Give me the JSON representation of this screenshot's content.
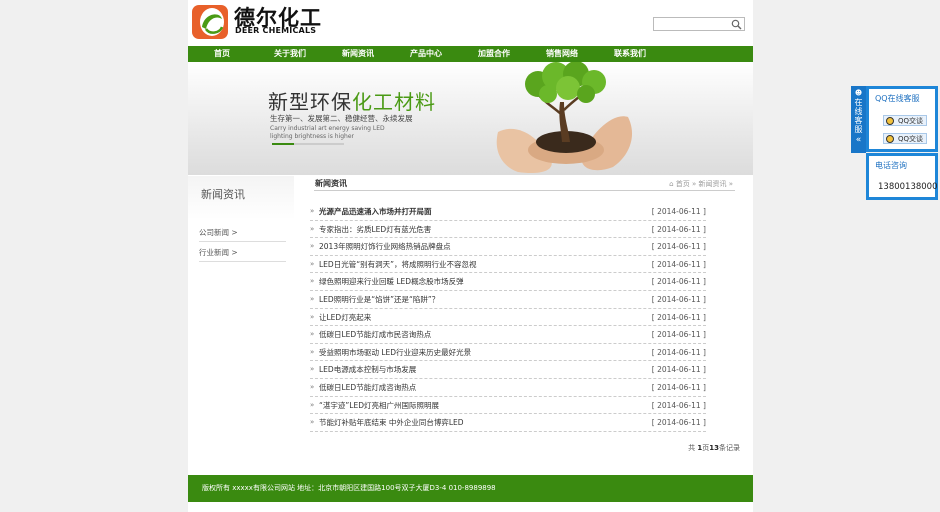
{
  "header": {
    "brand_cn": "德尔化工",
    "brand_en": "DEER CHEMICALS",
    "search_placeholder": "",
    "colors": {
      "brand_green": "#3a8a10",
      "logo_orange": "#e8602a",
      "logo_green": "#4a9a14"
    }
  },
  "nav": {
    "items": [
      {
        "label": "首页"
      },
      {
        "label": "关于我们"
      },
      {
        "label": "新闻资讯"
      },
      {
        "label": "产品中心"
      },
      {
        "label": "加盟合作"
      },
      {
        "label": "销售网络"
      },
      {
        "label": "联系我们"
      }
    ]
  },
  "banner": {
    "headline_part1": "新型环保",
    "headline_part2": "化工材料",
    "subtitle": "生存第一、发展第二、稳健经营、永续发展",
    "english": "Carry industrial art energy saving LED lighting brightness is higher"
  },
  "sidebar": {
    "title": "新闻资讯",
    "items": [
      {
        "label": "公司新闻  >"
      },
      {
        "label": "行业新闻  >"
      }
    ]
  },
  "main": {
    "title": "新闻资讯",
    "breadcrumb": "首页 » 新闻资讯 »",
    "news": [
      {
        "title": "光源产品迅速涌入市场并打开局面",
        "date": "[ 2014-06-11 ]"
      },
      {
        "title": "专家指出：劣质LED灯有蓝光危害",
        "date": "[ 2014-06-11 ]"
      },
      {
        "title": "2013年照明灯饰行业网络热销品牌盘点",
        "date": "[ 2014-06-11 ]"
      },
      {
        "title": "LED日光管“别有洞天”，将成照明行业不容忽视",
        "date": "[ 2014-06-11 ]"
      },
      {
        "title": "绿色照明迎来行业回暖 LED概念股市场反弹",
        "date": "[ 2014-06-11 ]"
      },
      {
        "title": "LED照明行业是“馅饼”还是“陷阱”？",
        "date": "[ 2014-06-11 ]"
      },
      {
        "title": "让LED灯亮起来",
        "date": "[ 2014-06-11 ]"
      },
      {
        "title": "低碳日LED节能灯成市民咨询热点",
        "date": "[ 2014-06-11 ]"
      },
      {
        "title": "受益照明市场驱动 LED行业迎来历史最好光景",
        "date": "[ 2014-06-11 ]"
      },
      {
        "title": "LED电源成本控制与市场发展",
        "date": "[ 2014-06-11 ]"
      },
      {
        "title": "低碳日LED节能灯成咨询热点",
        "date": "[ 2014-06-11 ]"
      },
      {
        "title": "“湛宇迹”LED灯亮相广州国际照明展",
        "date": "[ 2014-06-11 ]"
      },
      {
        "title": "节能灯补贴年底结束 中外企业同台博弈LED",
        "date": "[ 2014-06-11 ]"
      }
    ],
    "pager_prefix": "共 ",
    "pager_page": "1",
    "pager_mid": "页",
    "pager_count": "13",
    "pager_suffix": "条记录"
  },
  "footer": {
    "text": "版权所有 xxxxx有限公司网站  地址：北京市朝阳区建国路100号双子大厦D3-4 010-8989898"
  },
  "floating": {
    "tab_label": "在线客服",
    "tab_arrow": "«",
    "qq_title": "QQ在线客服",
    "qq_buttons": [
      {
        "label": "QQ交谈"
      },
      {
        "label": "QQ交谈"
      }
    ],
    "tel_title": "电话咨询",
    "tel_number": "13800138000"
  }
}
